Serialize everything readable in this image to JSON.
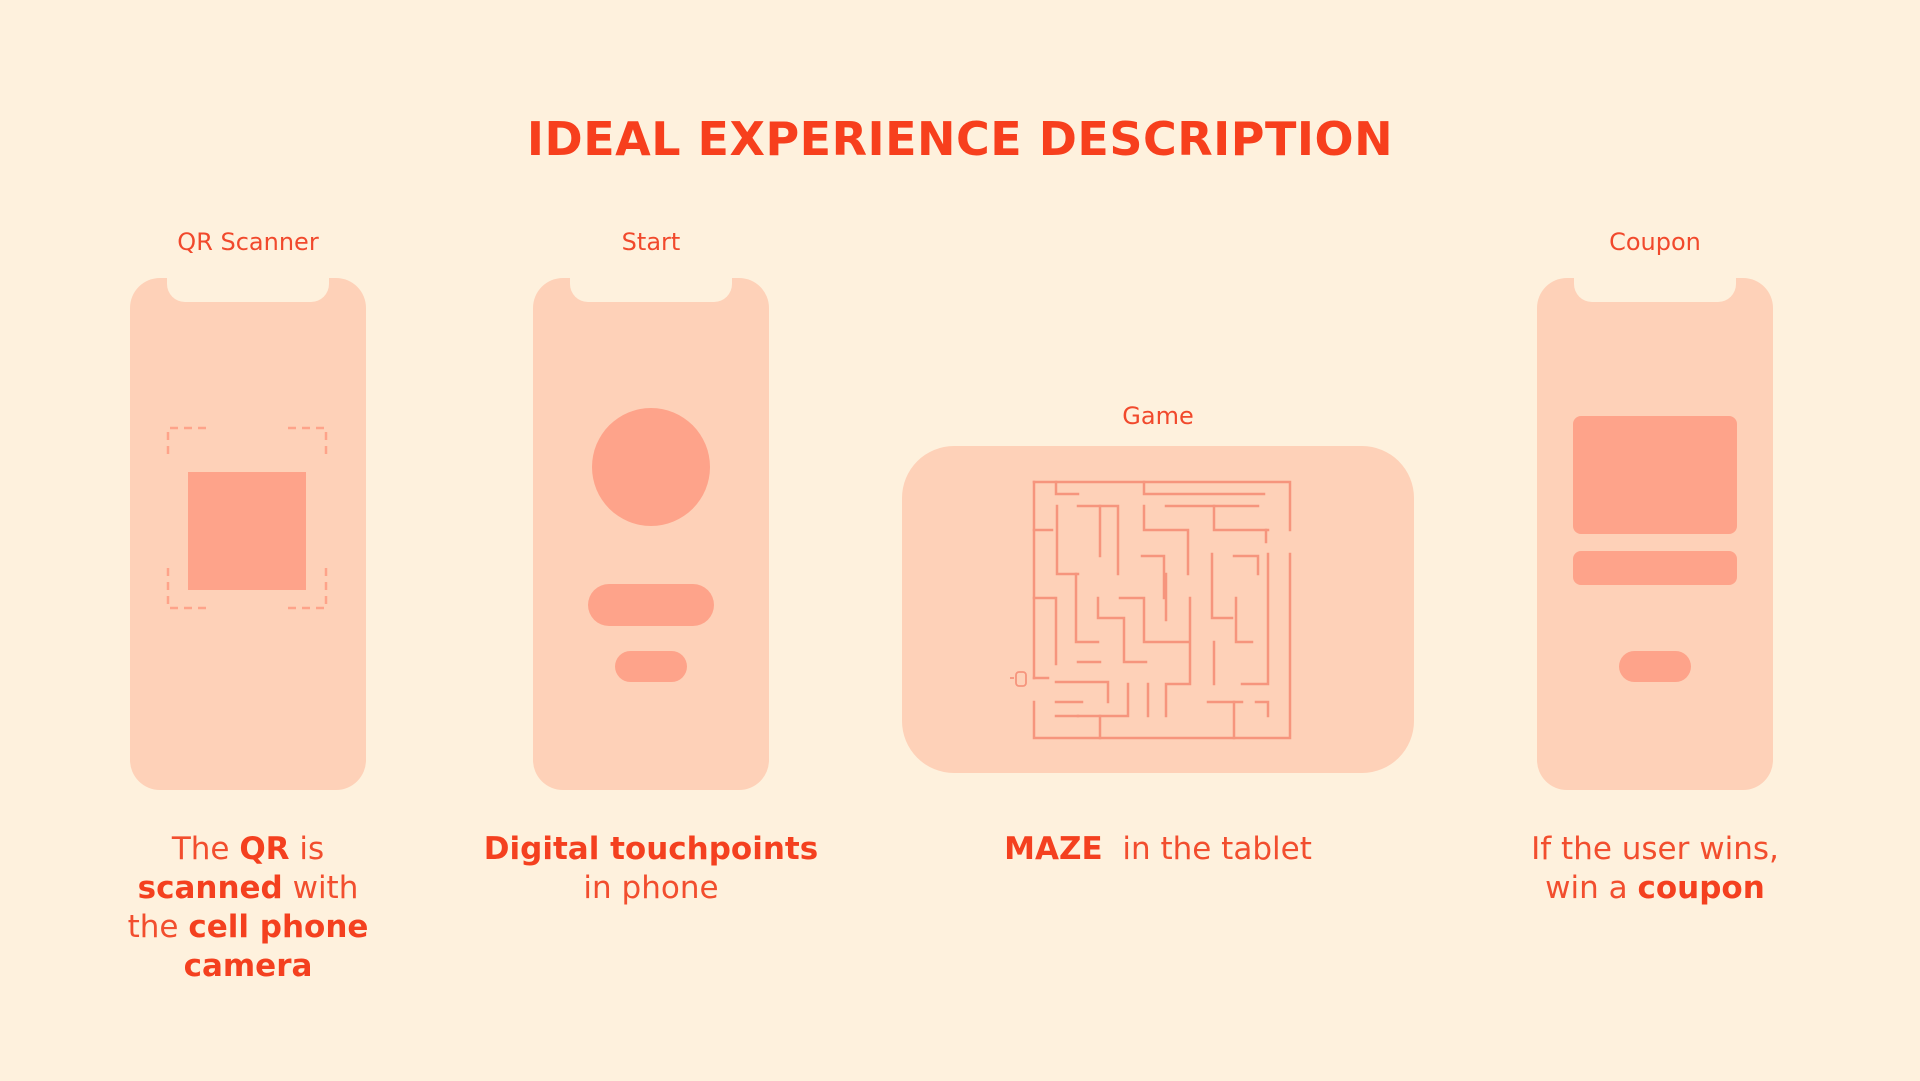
{
  "title": "IDEAL EXPERIENCE DESCRIPTION",
  "colors": {
    "background": "#fef1dd",
    "device": "#fed1b8",
    "element": "#fea38a",
    "accent": "#f7472a"
  },
  "screens": {
    "qr": {
      "label": "QR Scanner",
      "desc": [
        "The ",
        "QR",
        " is ",
        "scanned",
        " with the ",
        "cell phone camera"
      ]
    },
    "start": {
      "label": "Start",
      "desc": [
        "Digital touchpoints",
        " in phone"
      ]
    },
    "game": {
      "label": "Game",
      "desc": [
        "MAZE",
        "  in the tablet"
      ],
      "maze_icon": "maze-illustration"
    },
    "coupon": {
      "label": "Coupon",
      "desc": [
        "If the user wins, win a ",
        "coupon"
      ]
    }
  }
}
